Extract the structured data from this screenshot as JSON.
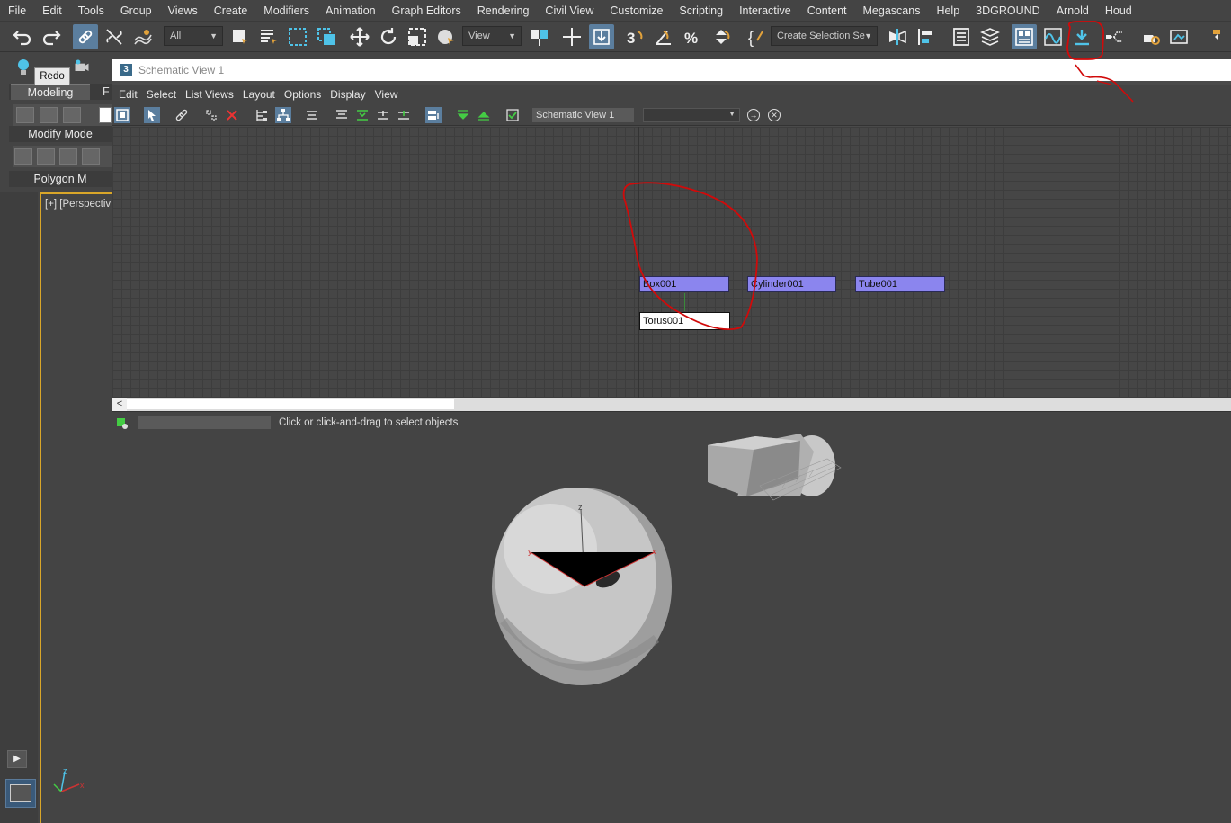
{
  "menu": [
    "File",
    "Edit",
    "Tools",
    "Group",
    "Views",
    "Create",
    "Modifiers",
    "Animation",
    "Graph Editors",
    "Rendering",
    "Civil View",
    "Customize",
    "Scripting",
    "Interactive",
    "Content",
    "Megascans",
    "Help",
    "3DGROUND",
    "Arnold",
    "Houd"
  ],
  "toolbar": {
    "selection_filter": "All",
    "ref_coord": "View",
    "named_selection": "Create Selection Se",
    "icons": [
      "undo-icon",
      "redo-icon",
      "select-link-icon",
      "unlink-icon",
      "bind-spacewarp-icon",
      "select-object-icon",
      "select-by-name-icon",
      "rect-selection-icon",
      "window-crossing-icon",
      "move-icon",
      "rotate-icon",
      "scale-icon",
      "place-icon",
      "pivot-icon",
      "snap-3d-icon",
      "angle-snap-icon",
      "percent-snap-icon",
      "spinner-snap-icon",
      "edit-named-selection-icon",
      "mirror-icon",
      "align-icon",
      "layer-explorer-icon",
      "toggle-ribbon-icon",
      "curve-editor-icon",
      "schematic-view-icon",
      "material-editor-icon",
      "render-setup-icon",
      "rendered-frame-icon",
      "render-icon"
    ]
  },
  "tooltip": "Redo",
  "ribbon": {
    "tab_modeling": "Modeling",
    "tab_next": "F",
    "modify_mode": "Modify Mode",
    "polygon_mode": "Polygon M"
  },
  "viewport": {
    "label": "[+] [Perspectiv"
  },
  "schematic": {
    "app_icon": "3",
    "title": "Schematic View 1",
    "menu": [
      "Edit",
      "Select",
      "List Views",
      "Layout",
      "Options",
      "Display",
      "View"
    ],
    "name_field": "Schematic View 1",
    "dropdown_value": "",
    "nodes": [
      {
        "label": "Box001",
        "selected": false
      },
      {
        "label": "Cylinder001",
        "selected": false
      },
      {
        "label": "Tube001",
        "selected": false
      },
      {
        "label": "Torus001",
        "selected": true
      }
    ],
    "scroll_left": "<",
    "status": "Click or click-and-drag to select objects"
  },
  "colors": {
    "node_fill": "#8b85ee",
    "annotation": "#d10a0a",
    "viewport_border": "#d9a629",
    "active_tool": "#5b7e9e"
  }
}
